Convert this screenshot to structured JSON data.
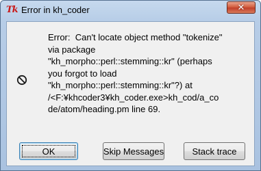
{
  "window": {
    "title": "Error in kh_coder",
    "app_icon_text": "Tk",
    "close_glyph": "✕"
  },
  "dialog": {
    "message_lines": [
      "Error:  Can't locate object method \"tokenize\"",
      "via package",
      "\"kh_morpho::perl::stemming::kr\" (perhaps",
      "you forgot to load",
      "\"kh_morpho::perl::stemming::kr\"?) at",
      "/<F:¥khcoder3¥kh_coder.exe>kh_cod/a_co",
      "de/atom/heading.pm line 69."
    ],
    "icon": "error-icon",
    "buttons": {
      "ok": "OK",
      "skip": "Skip Messages",
      "stack": "Stack trace"
    }
  },
  "colors": {
    "frame": "#b7cde7",
    "client": "#f0f0f0",
    "close_button": "#c1402a",
    "app_icon": "#c81818"
  }
}
